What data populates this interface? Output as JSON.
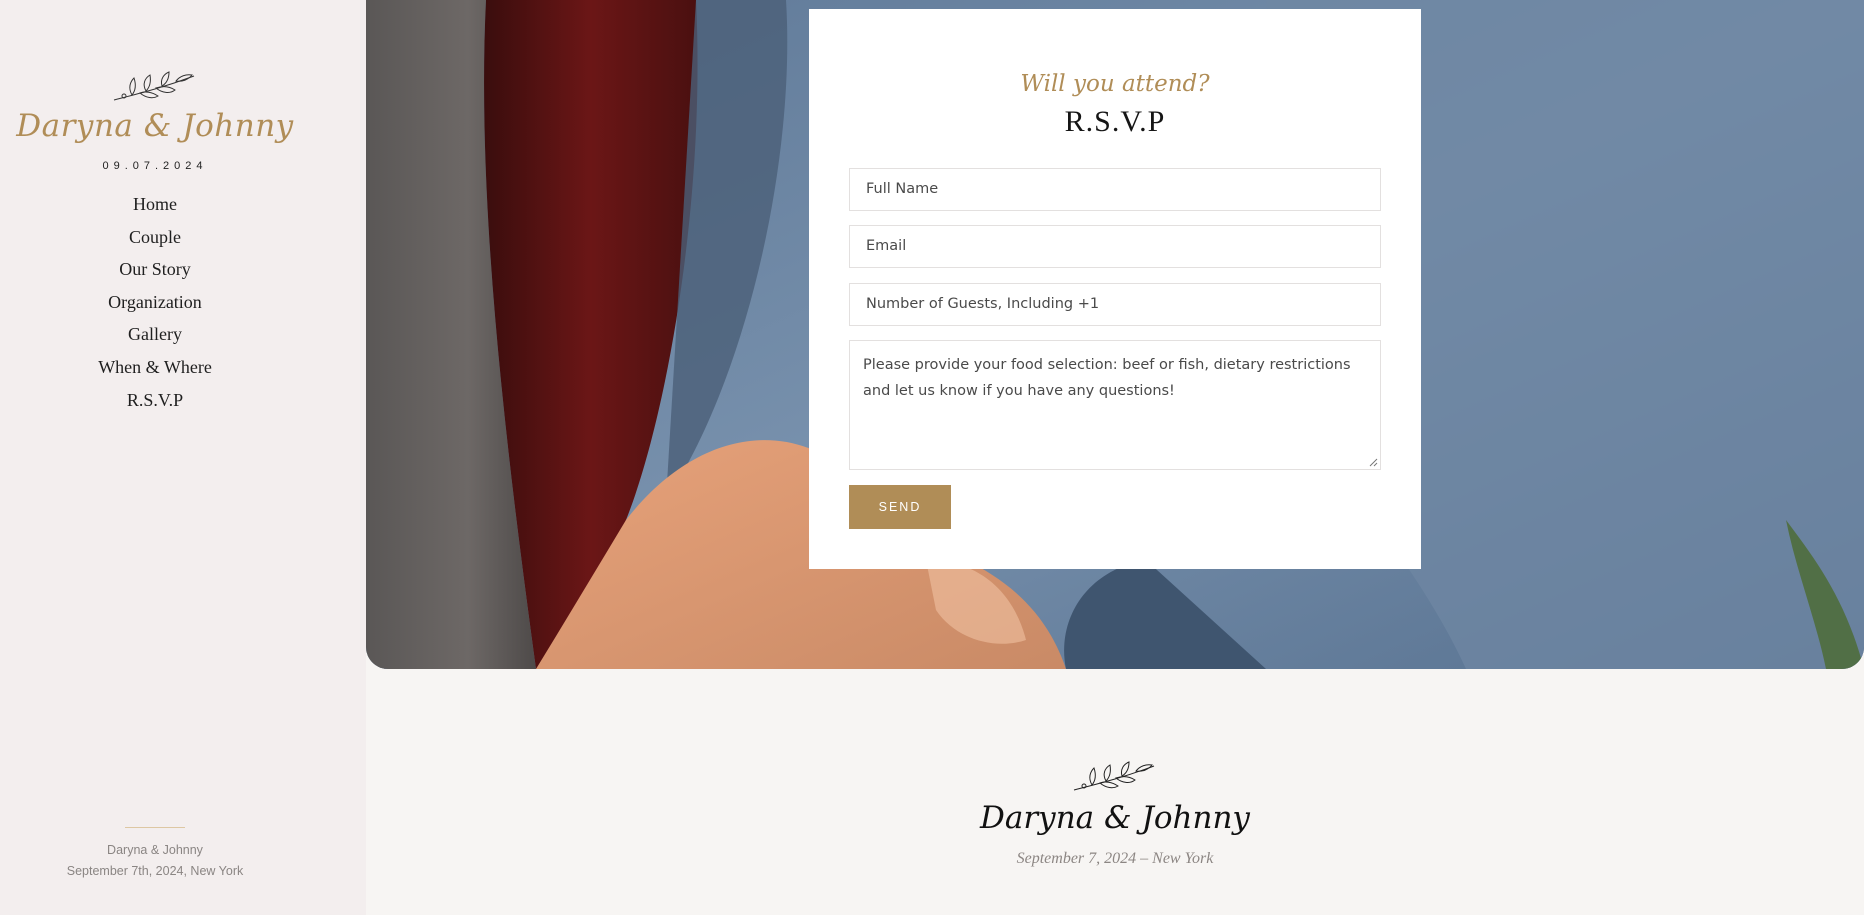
{
  "sidebar": {
    "names": "Daryna & Johnny",
    "date": "09.07.2024",
    "nav": [
      {
        "label": "Home"
      },
      {
        "label": "Couple"
      },
      {
        "label": "Our Story"
      },
      {
        "label": "Organization"
      },
      {
        "label": "Gallery"
      },
      {
        "label": "When & Where"
      },
      {
        "label": "R.S.V.P"
      }
    ],
    "footer_names": "Daryna & Johnny",
    "footer_date": "September 7th, 2024, New York"
  },
  "rsvp": {
    "kicker": "Will you attend?",
    "title": "R.S.V.P",
    "fields": {
      "full_name_placeholder": "Full Name",
      "email_placeholder": "Email",
      "guests_placeholder": "Number of Guests, Including +1",
      "message_placeholder": "Please provide your food selection: beef or fish, dietary restrictions and let us know if you have any questions!"
    },
    "send_label": "SEND"
  },
  "footer": {
    "names": "Daryna & Johnny",
    "subtitle": "September 7, 2024 – New York"
  },
  "colors": {
    "accent": "#b08d57",
    "sidebar_bg": "#f3eeee",
    "page_bg": "#f7f5f3"
  },
  "icons": [
    "floral-branch-icon",
    "resize-grip-icon"
  ]
}
